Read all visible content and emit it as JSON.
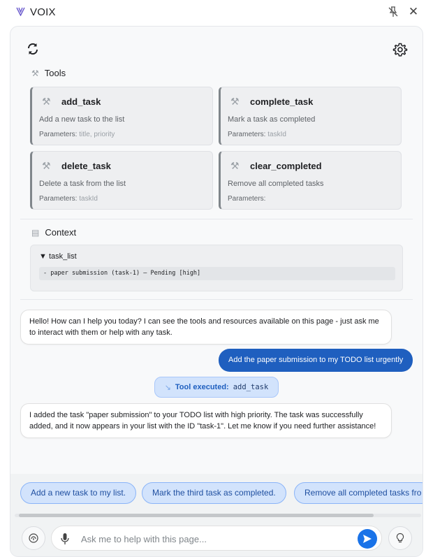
{
  "window": {
    "title": "VOIX",
    "logo": "v-logo",
    "pin_icon": "pin-off-icon",
    "close_icon": "close-icon"
  },
  "header": {
    "refresh_icon": "refresh-icon",
    "settings_icon": "gear-icon"
  },
  "tools": {
    "title": "Tools",
    "icon": "tools-icon",
    "params_label": "Parameters:",
    "items": [
      {
        "name": "add_task",
        "description": "Add a new task to the list",
        "params": "title, priority"
      },
      {
        "name": "complete_task",
        "description": "Mark a task as completed",
        "params": "taskId"
      },
      {
        "name": "delete_task",
        "description": "Delete a task from the list",
        "params": "taskId"
      },
      {
        "name": "clear_completed",
        "description": "Remove all completed tasks",
        "params": ""
      }
    ]
  },
  "context": {
    "title": "Context",
    "icon": "document-icon",
    "summary": "▼ task_list",
    "content": "- paper submission (task-1) – Pending [high]"
  },
  "chat": {
    "greeting": "Hello! How can I help you today? I can see the tools and resources available on this page - just ask me to interact with them or help with any task.",
    "user_message": "Add the paper submission to my TODO list urgently",
    "tool_executed_label": "Tool executed:",
    "tool_executed_name": "add_task",
    "reply": "I added the task \"paper submission\" to your TODO list with high priority. The task was successfully added, and it now appears in your list with the ID \"task-1\". Let me know if you need further assistance!"
  },
  "suggestions": [
    "Add a new task to my list.",
    "Mark the third task as completed.",
    "Remove all completed tasks fro"
  ],
  "composer": {
    "placeholder": "Ask me to help with this page...",
    "left_icon": "fingerprint-icon",
    "mic_icon": "microphone-icon",
    "send_icon": "send-icon",
    "right_icon": "lightbulb-icon"
  },
  "colors": {
    "accent": "#1a73e8",
    "user_bubble": "#1f5fbf",
    "chip_bg": "#d2e3fc"
  }
}
